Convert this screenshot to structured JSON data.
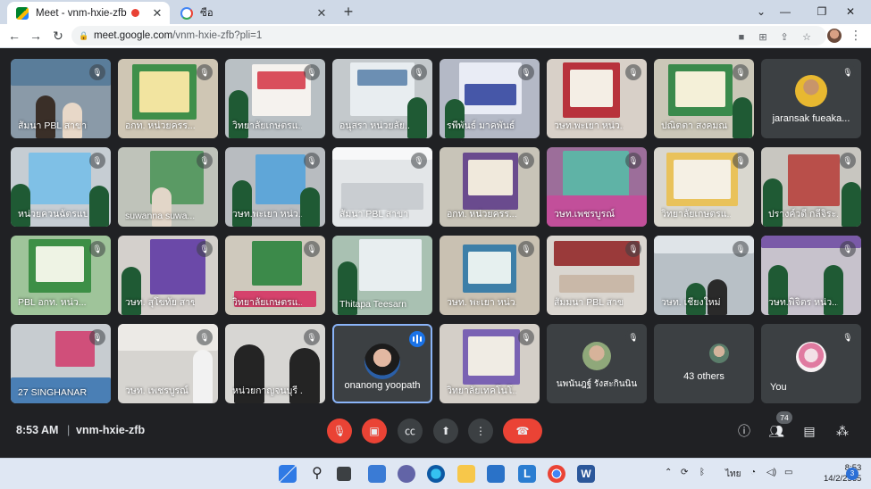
{
  "browser": {
    "tabs": [
      {
        "title": "Meet - vnm-hxie-zfb",
        "active": true
      },
      {
        "title": "ซือ",
        "active": false
      }
    ],
    "url_main": "meet.google.com",
    "url_path": "/vnm-hxie-zfb?pli=1"
  },
  "participants": [
    {
      "name": "สัมนา PBL สาขาว...",
      "muted": true
    },
    {
      "name": "อกท. หน่วยครร...",
      "muted": true
    },
    {
      "name": "วิทยาลัยเกษตรแ...",
      "muted": true
    },
    {
      "name": "อนุสรา หน่วยลัย...",
      "muted": true
    },
    {
      "name": "รพีพันธ์ มาคพันธ์",
      "muted": true
    },
    {
      "name": "วษท.พะเยา หน่ว...",
      "muted": true
    },
    {
      "name": "ปณิตตา สงคมณ",
      "muted": true
    },
    {
      "name": "jaransak fueaka...",
      "muted": true
    },
    {
      "name": "หน่วยควนฉัตรแป...",
      "muted": true
    },
    {
      "name": "suwanna suwa...",
      "muted": true
    },
    {
      "name": "วษท.พะเยา หน่ว...",
      "muted": true
    },
    {
      "name": "สัมนา PBL สาขา...",
      "muted": true
    },
    {
      "name": "อกท. หน่วยครร...",
      "muted": true
    },
    {
      "name": "วษท.เพชรบูรณ์",
      "muted": true
    },
    {
      "name": "วิทยาลัยเกษตรแ...",
      "muted": true
    },
    {
      "name": "ปรางค์วดี กลีจิระ...",
      "muted": true
    },
    {
      "name": "PBL อกท. หน่ว...",
      "muted": true
    },
    {
      "name": "วษท. สุโขทัย สาข...",
      "muted": true
    },
    {
      "name": "วิทยาลัยเกษตรแ...",
      "muted": true
    },
    {
      "name": "Thitapa Teesarn",
      "muted": false
    },
    {
      "name": "วษท. พะเยา หน่ว...",
      "muted": true
    },
    {
      "name": "สัมมนา PBL สาข...",
      "muted": true
    },
    {
      "name": "วษท. เชียงใหม่",
      "muted": true
    },
    {
      "name": "วษท.พิจิตร หน่ว...",
      "muted": true
    },
    {
      "name": "27 SINGHANAR...",
      "muted": true
    },
    {
      "name": "วษท. เพชรบูรณ์",
      "muted": true
    },
    {
      "name": "หน่วยกาญจนบุรี ...",
      "muted": true
    },
    {
      "name": "onanong yoopath",
      "muted": false,
      "speaking": true
    },
    {
      "name": "วิทยาลัยเทคโนโ...",
      "muted": true
    },
    {
      "name": "นพนันฎฐ์ รังสะกินนิน",
      "muted": true
    },
    {
      "name": "43 others",
      "muted": false
    },
    {
      "name": "You",
      "muted": true
    }
  ],
  "callbar": {
    "time": "8:53 AM",
    "separator": "|",
    "meeting_code": "vnm-hxie-zfb",
    "people_count": "74"
  },
  "taskbar": {
    "lang": "ไทย",
    "time": "8:53",
    "date": "14/2/2565",
    "notifications": "3"
  },
  "colors": {
    "speaking_border": "#8ab4f8",
    "end_call": "#ea4335",
    "meet_bg": "#202124",
    "tile_dark": "#3c4043"
  }
}
